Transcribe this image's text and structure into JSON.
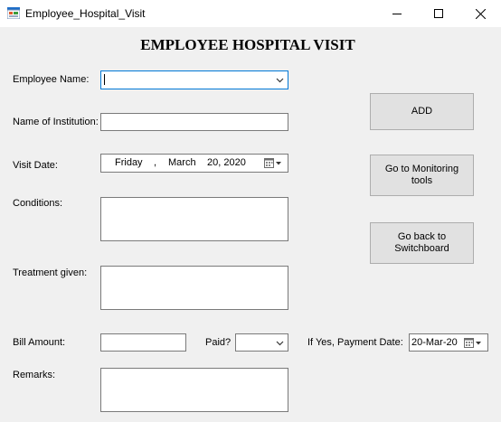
{
  "window": {
    "title": "Employee_Hospital_Visit"
  },
  "heading": "EMPLOYEE HOSPITAL VISIT",
  "form": {
    "employee_name_label": "Employee Name:",
    "employee_name_value": "",
    "institution_label": "Name of Institution:",
    "institution_value": "",
    "visit_date_label": "Visit Date:",
    "visit_date": {
      "weekday": "Friday",
      "sep": ",",
      "month": "March",
      "day_year": "20, 2020"
    },
    "conditions_label": "Conditions:",
    "conditions_value": "",
    "treatment_label": "Treatment given:",
    "treatment_value": "",
    "bill_label": "Bill Amount:",
    "bill_value": "",
    "paid_label": "Paid?",
    "paid_value": "",
    "payment_date_label": "If Yes, Payment Date:",
    "payment_date_value": "20-Mar-20",
    "remarks_label": "Remarks:",
    "remarks_value": ""
  },
  "buttons": {
    "add": "ADD",
    "monitoring": "Go to Monitoring\ntools",
    "switchboard": "Go back to\nSwitchboard"
  },
  "icons": {
    "app": "form-window-icon",
    "minimize": "minimize-icon",
    "maximize": "maximize-icon",
    "close": "close-icon",
    "dropdown": "chevron-down-icon",
    "calendar": "calendar-icon"
  },
  "colors": {
    "focus_border": "#0078d7",
    "button_face": "#e1e1e1",
    "background": "#f0f0f0"
  }
}
